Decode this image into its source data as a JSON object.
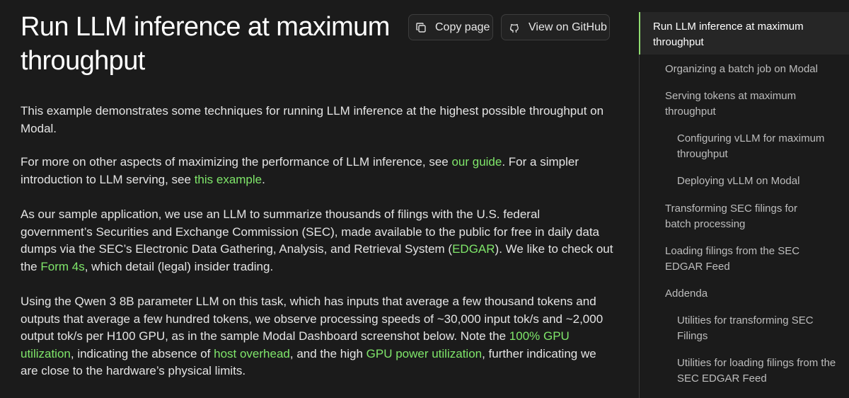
{
  "title": "Run LLM inference at maximum throughput",
  "buttons": {
    "copy_label": "Copy page",
    "github_label": "View on GitHub"
  },
  "icons": [
    "copy-icon",
    "github-icon"
  ],
  "colors": {
    "background": "#1b1b1b",
    "link": "#7fe66a",
    "toc_active_bar": "#8fdc70"
  },
  "paragraphs": {
    "p1": {
      "t1": "This example demonstrates some techniques for running LLM inference at the highest possible throughput on Modal."
    },
    "p2": {
      "t1": "For more on other aspects of maximizing the performance of LLM inference, see ",
      "link1": "our guide",
      "t2": ". For a simpler introduction to LLM serving, see ",
      "link2": "this example",
      "t3": "."
    },
    "p3": {
      "t1": "As our sample application, we use an LLM to summarize thousands of filings with the U.S. federal government’s Securities and Exchange Commission (SEC), made available to the public for free in daily data dumps via the SEC’s Electronic Data Gathering, Analysis, and Retrieval System (",
      "link1": "EDGAR",
      "t2": "). We like to check out the ",
      "link2": "Form 4s",
      "t3": ", which detail (legal) insider trading."
    },
    "p4": {
      "t1": "Using the Qwen 3 8B parameter LLM on this task, which has inputs that average a few thousand tokens and outputs that average a few hundred tokens, we observe processing speeds of ~30,000 input tok/s and ~2,000 output tok/s per H100 GPU, as in the sample Modal Dashboard screenshot below. Note the ",
      "link1": "100% GPU utilization",
      "t2": ", indicating the absence of ",
      "link2": "host overhead",
      "t3": ", and the high ",
      "link3": "GPU power utilization",
      "t4": ", further indicating we are close to the hardware’s physical limits."
    }
  },
  "toc": {
    "items": [
      {
        "label": "Run LLM inference at maximum throughput",
        "active": true
      },
      {
        "label": "Organizing a batch job on Modal"
      },
      {
        "label": "Serving tokens at maximum throughput"
      },
      {
        "label": "Configuring vLLM for maximum throughput"
      },
      {
        "label": "Deploying vLLM on Modal"
      },
      {
        "label": "Transforming SEC filings for batch processing"
      },
      {
        "label": "Loading filings from the SEC EDGAR Feed"
      },
      {
        "label": "Addenda"
      },
      {
        "label": "Utilities for transforming SEC Filings"
      },
      {
        "label": "Utilities for loading filings from the SEC EDGAR Feed"
      }
    ]
  }
}
